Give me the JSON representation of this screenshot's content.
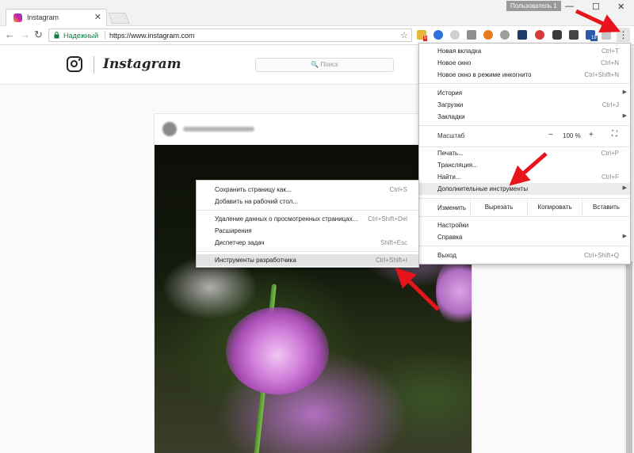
{
  "browser": {
    "tab_title": "Instagram",
    "tab_close": "✕",
    "user_badge": "Пользователь 1",
    "window_buttons": {
      "minimize": "—",
      "maximize": "☐",
      "close": "✕"
    },
    "nav": {
      "back": "←",
      "forward": "→",
      "reload": "↻"
    },
    "secure_label": "Надежный",
    "url": "https://www.instagram.com",
    "star": "☆",
    "extension_badges": {
      "first": "5",
      "second": "19"
    },
    "menu_button": "⋮"
  },
  "instagram": {
    "wordmark": "Instagram",
    "search_placeholder": "🔍 Поиск"
  },
  "menu": {
    "new_tab": {
      "label": "Новая вкладка",
      "shortcut": "Ctrl+T"
    },
    "new_window": {
      "label": "Новое окно",
      "shortcut": "Ctrl+N"
    },
    "incognito": {
      "label": "Новое окно в режиме инкогнито",
      "shortcut": "Ctrl+Shift+N"
    },
    "history": {
      "label": "История"
    },
    "downloads": {
      "label": "Загрузки",
      "shortcut": "Ctrl+J"
    },
    "bookmarks": {
      "label": "Закладки"
    },
    "zoom": {
      "label": "Масштаб",
      "minus": "−",
      "value": "100 %",
      "plus": "+",
      "fullscreen": "⛶"
    },
    "print": {
      "label": "Печать...",
      "shortcut": "Ctrl+P"
    },
    "cast": {
      "label": "Трансляция..."
    },
    "find": {
      "label": "Найти...",
      "shortcut": "Ctrl+F"
    },
    "more_tools": {
      "label": "Дополнительные инструменты"
    },
    "edit": {
      "label": "Изменить",
      "cut": "Вырезать",
      "copy": "Копировать",
      "paste": "Вставить"
    },
    "settings": {
      "label": "Настройки"
    },
    "help": {
      "label": "Справка"
    },
    "exit": {
      "label": "Выход",
      "shortcut": "Ctrl+Shift+Q"
    },
    "submenu_arrow": "▶"
  },
  "submenu": {
    "save_page": {
      "label": "Сохранить страницу как...",
      "shortcut": "Ctrl+S"
    },
    "add_desktop": {
      "label": "Добавить на рабочий стол..."
    },
    "clear_data": {
      "label": "Удаление данных о просмотренных страницах...",
      "shortcut": "Ctrl+Shift+Del"
    },
    "extensions": {
      "label": "Расширения"
    },
    "task_manager": {
      "label": "Диспетчер задач",
      "shortcut": "Shift+Esc"
    },
    "dev_tools": {
      "label": "Инструменты разработчика",
      "shortcut": "Ctrl+Shift+I"
    }
  },
  "colors": {
    "annotation_arrow": "#e8141b",
    "secure_green": "#0b8043"
  }
}
